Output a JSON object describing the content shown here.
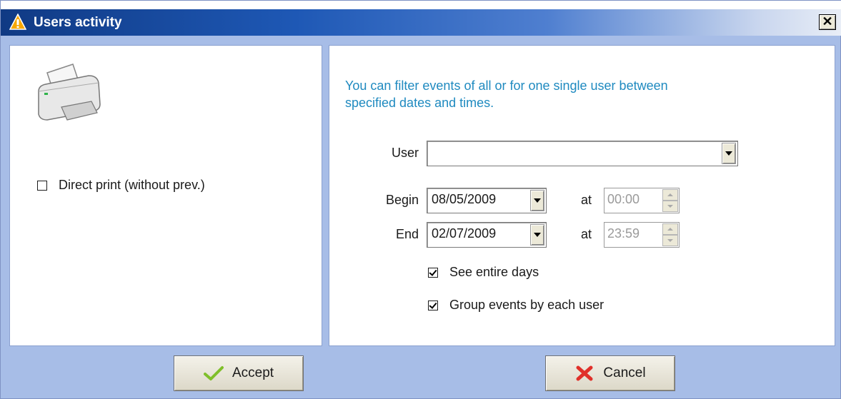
{
  "window": {
    "title": "Users activity"
  },
  "left_panel": {
    "direct_print_label": "Direct print (without prev.)",
    "direct_print_checked": false
  },
  "right_panel": {
    "info_line1": "You can filter events of all or for one single user between",
    "info_line2": "specified dates and times.",
    "user_label": "User",
    "user_value": "",
    "begin_label": "Begin",
    "begin_date": "08/05/2009",
    "begin_at_label": "at",
    "begin_time": "00:00",
    "end_label": "End",
    "end_date": "02/07/2009",
    "end_at_label": "at",
    "end_time": "23:59",
    "see_entire_days_label": "See entire days",
    "see_entire_days_checked": true,
    "group_events_label": "Group events by each user",
    "group_events_checked": true
  },
  "buttons": {
    "accept_label": "Accept",
    "cancel_label": "Cancel"
  },
  "colors": {
    "info_text": "#1f8ac0",
    "window_background": "#a7bde7",
    "title_bar_start": "#103a84"
  },
  "icons": [
    "warning-triangle-icon",
    "close-icon",
    "printer-icon",
    "checkmark-icon",
    "x-cancel-icon",
    "chevron-down-icon"
  ]
}
